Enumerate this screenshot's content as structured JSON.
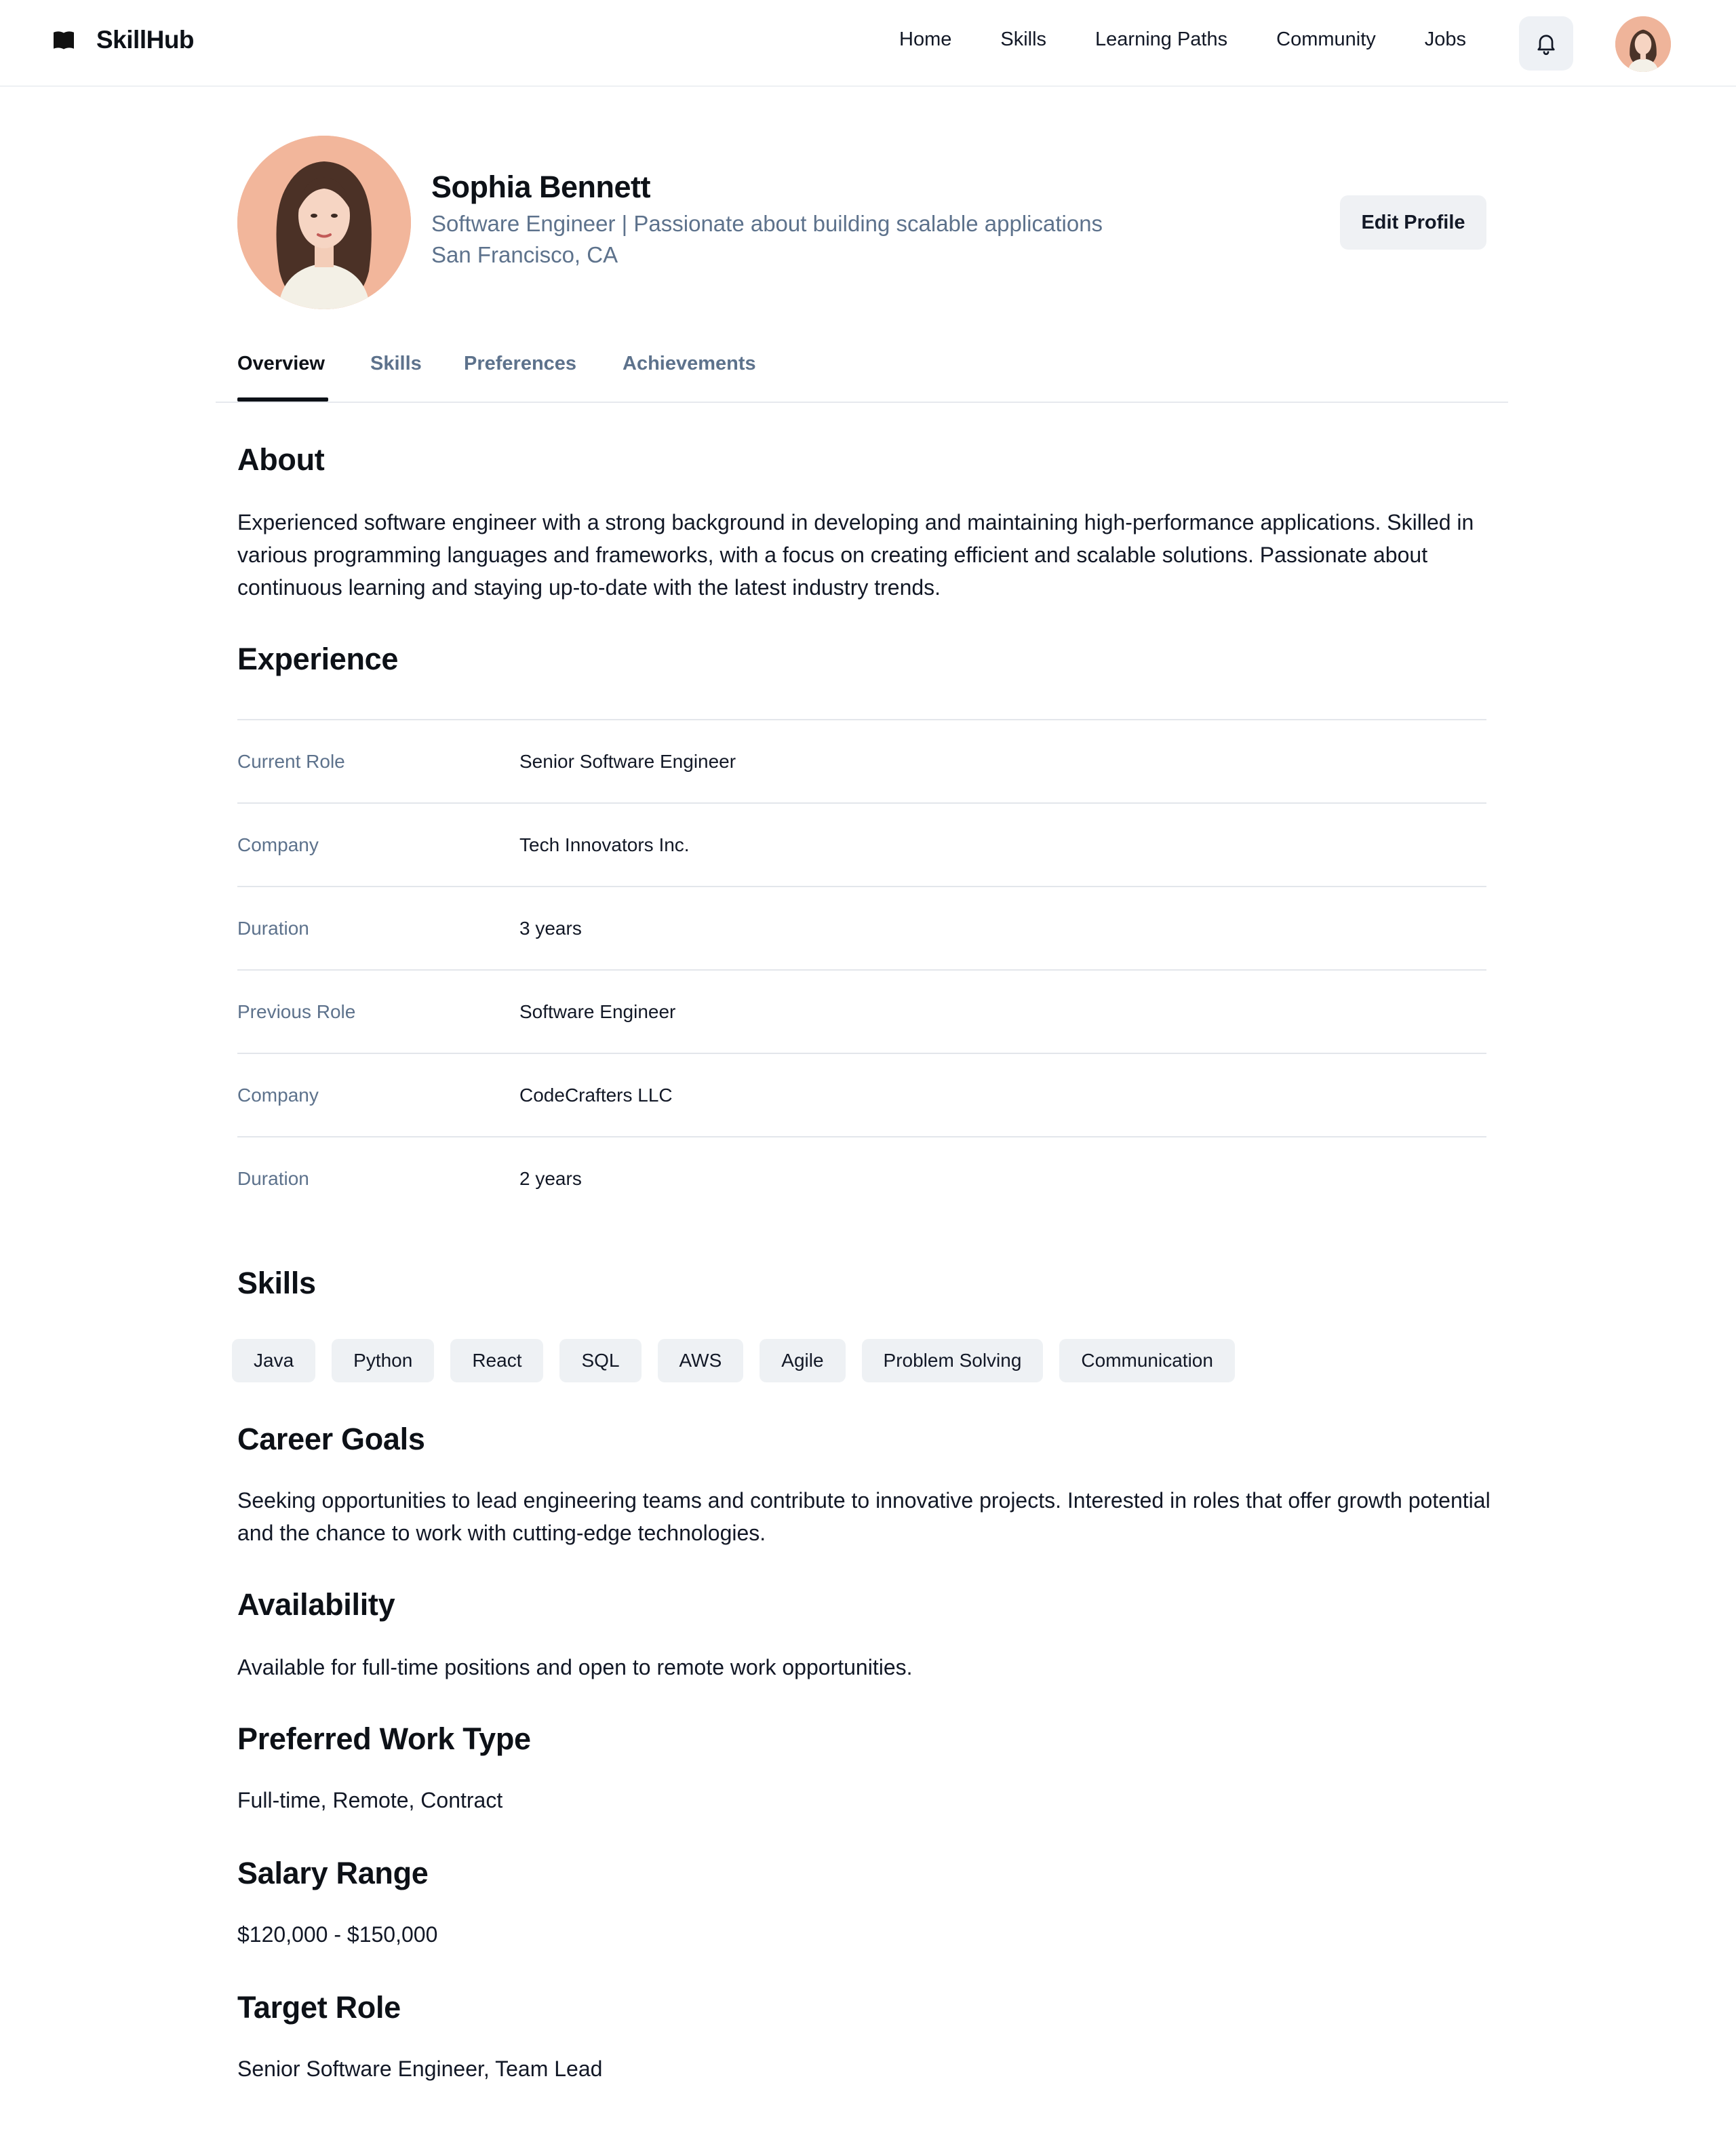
{
  "brand": {
    "name": "SkillHub",
    "icon": "book-icon"
  },
  "nav": {
    "items": [
      "Home",
      "Skills",
      "Learning Paths",
      "Community",
      "Jobs"
    ],
    "bell_icon": "bell-icon"
  },
  "profile": {
    "name": "Sophia Bennett",
    "headline": "Software Engineer | Passionate about building scalable applications",
    "location": "San Francisco, CA",
    "edit_label": "Edit Profile"
  },
  "tabs": [
    {
      "label": "Overview",
      "active": true
    },
    {
      "label": "Skills",
      "active": false
    },
    {
      "label": "Preferences",
      "active": false
    },
    {
      "label": "Achievements",
      "active": false
    }
  ],
  "about": {
    "title": "About",
    "text": "Experienced software engineer with a strong background in developing and maintaining high-performance applications. Skilled in various programming languages and frameworks, with a focus on creating efficient and scalable solutions. Passionate about continuous learning and staying up-to-date with the latest industry trends."
  },
  "experience": {
    "title": "Experience",
    "rows": [
      {
        "label": "Current Role",
        "value": "Senior Software Engineer"
      },
      {
        "label": "Company",
        "value": "Tech Innovators Inc."
      },
      {
        "label": "Duration",
        "value": "3 years"
      },
      {
        "label": "Previous Role",
        "value": "Software Engineer"
      },
      {
        "label": "Company",
        "value": "CodeCrafters LLC"
      },
      {
        "label": "Duration",
        "value": "2 years"
      }
    ]
  },
  "skills": {
    "title": "Skills",
    "items": [
      "Java",
      "Python",
      "React",
      "SQL",
      "AWS",
      "Agile",
      "Problem Solving",
      "Communication"
    ]
  },
  "career_goals": {
    "title": "Career Goals",
    "text": "Seeking opportunities to lead engineering teams and contribute to innovative projects. Interested in roles that offer growth potential and the chance to work with cutting-edge technologies."
  },
  "availability": {
    "title": "Availability",
    "text": "Available for full-time positions and open to remote work opportunities."
  },
  "preferred_work_type": {
    "title": "Preferred Work Type",
    "text": "Full-time, Remote, Contract"
  },
  "salary_range": {
    "title": "Salary Range",
    "text": "$120,000 - $150,000"
  },
  "target_role": {
    "title": "Target Role",
    "text": "Senior Software Engineer, Team Lead"
  },
  "colors": {
    "muted": "#5d728c",
    "text": "#0d1117",
    "chip_bg": "#eef1f4",
    "avatar_bg": "#f2b69b"
  }
}
